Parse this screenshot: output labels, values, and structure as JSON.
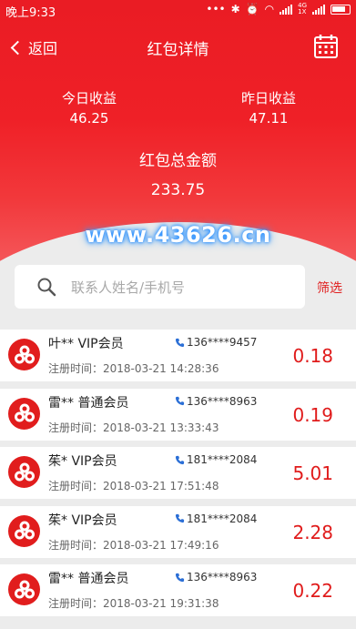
{
  "status_bar": {
    "time": "晚上9:33",
    "network": "4G",
    "network_sub": "1X"
  },
  "nav": {
    "back_label": "返回",
    "title": "红包详情"
  },
  "stats": {
    "today_label": "今日收益",
    "today_value": "46.25",
    "yesterday_label": "昨日收益",
    "yesterday_value": "47.11",
    "total_label": "红包总金额",
    "total_value": "233.75"
  },
  "watermark": "www.43626.cn",
  "search": {
    "placeholder": "联系人姓名/手机号"
  },
  "filter_label": "筛选",
  "members": [
    {
      "name": "叶**  VIP会员",
      "phone": "136****9457",
      "reg": "注册时间：2018-03-21 14:28:36",
      "amount": "0.18"
    },
    {
      "name": "雷**  普通会员",
      "phone": "136****8963",
      "reg": "注册时间：2018-03-21 13:33:43",
      "amount": "0.19"
    },
    {
      "name": "茱*  VIP会员",
      "phone": "181****2084",
      "reg": "注册时间：2018-03-21 17:51:48",
      "amount": "5.01"
    },
    {
      "name": "茱*  VIP会员",
      "phone": "181****2084",
      "reg": "注册时间：2018-03-21 17:49:16",
      "amount": "2.28"
    },
    {
      "name": "雷**  普通会员",
      "phone": "136****8963",
      "reg": "注册时间：2018-03-21 19:31:38",
      "amount": "0.22"
    }
  ],
  "colors": {
    "brand_red": "#ea1c24",
    "amount_red": "#e01b1b",
    "phone_icon": "#2b6fd6"
  }
}
